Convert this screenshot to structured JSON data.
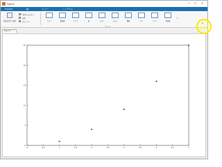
{
  "window": {
    "title": "Figure"
  },
  "controls": {
    "minimize": "—",
    "maximize": "☐",
    "close": "✕"
  },
  "tabs": [
    "FIGURE",
    "軸",
    "ビュー",
    "レイアウト"
  ],
  "ribbon": {
    "big_button_label": "名前を付けて保存",
    "checkboxes": [
      "Figure のコピー",
      "凡例",
      "カラーバー"
    ],
    "gallery_items": [
      "ライン",
      "散布図",
      "エリア",
      "棒",
      "ヒスト",
      "ステム",
      "階段",
      "パイ",
      "エラー",
      "等高線"
    ],
    "gallery_caption": "プロット",
    "gallery_more": "▾"
  },
  "figure_tab": {
    "label": "Figure 1",
    "close": "×"
  },
  "side_button": "▸",
  "chart_data": {
    "type": "scatter",
    "title": "",
    "xlabel": "",
    "ylabel": "",
    "xlim": [
      0,
      5
    ],
    "ylim": [
      0,
      25
    ],
    "x_ticks": [
      "0",
      "0.5",
      "1",
      "1.5",
      "2",
      "2.5",
      "3",
      "3.5",
      "4",
      "4.5",
      "5"
    ],
    "y_ticks": [
      "0",
      "5",
      "10",
      "15",
      "20",
      "25"
    ],
    "points": [
      {
        "x": 1,
        "y": 1
      },
      {
        "x": 2,
        "y": 4
      },
      {
        "x": 3,
        "y": 9
      },
      {
        "x": 4,
        "y": 16
      },
      {
        "x": 5,
        "y": 25
      }
    ],
    "marker_color": "#0072bd",
    "grid": false
  }
}
